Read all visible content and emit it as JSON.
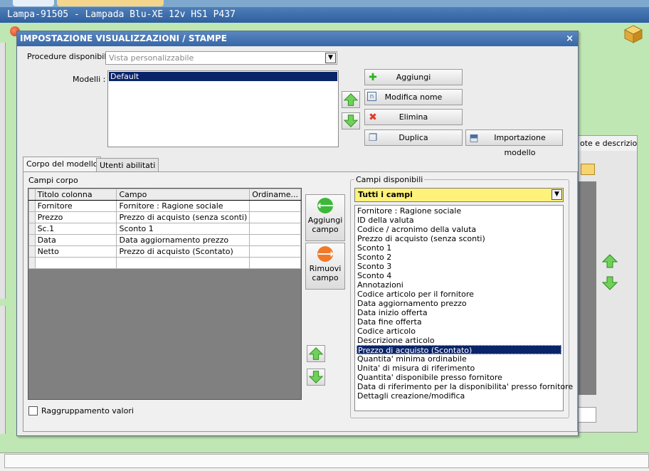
{
  "window": {
    "title": "Lampa-91505 - Lampada Blu-XE 12v HS1 P437"
  },
  "background": {
    "tab_note": "ote e descrizioni"
  },
  "dialog": {
    "title": "IMPOSTAZIONE VISUALIZZAZIONI / STAMPE",
    "close": "×",
    "procedure_label": "Procedure disponibili :",
    "procedure_value": "Vista personalizzabile",
    "modelli_label": "Modelli :",
    "modelli": [
      "Default"
    ],
    "buttons": {
      "aggiungi": "Aggiungi",
      "modifica": "Modifica nome",
      "elimina": "Elimina",
      "duplica": "Duplica",
      "importazione": "Importazione modello"
    },
    "tabs": [
      "Corpo del modello",
      "Utenti abilitati"
    ],
    "campi_corpo_label": "Campi corpo",
    "grid": {
      "columns": [
        "Titolo colonna",
        "Campo",
        "Ordiname..."
      ],
      "rows": [
        {
          "titolo": "Fornitore",
          "campo": "Fornitore : Ragione sociale",
          "ord": ""
        },
        {
          "titolo": "Prezzo",
          "campo": "Prezzo di acquisto (senza sconti)",
          "ord": ""
        },
        {
          "titolo": "Sc.1",
          "campo": "Sconto 1",
          "ord": ""
        },
        {
          "titolo": "Data",
          "campo": "Data aggiornamento prezzo",
          "ord": ""
        },
        {
          "titolo": "Netto",
          "campo": "Prezzo di acquisto (Scontato)",
          "ord": ""
        },
        {
          "titolo": "",
          "campo": "",
          "ord": ""
        }
      ]
    },
    "aggiungi_campo": [
      "Aggiungi",
      "campo"
    ],
    "rimuovi_campo": [
      "Rimuovi",
      "campo"
    ],
    "raggruppamento_label": "Raggruppamento valori",
    "campi_disponibili_label": "Campi disponibili",
    "campi_filter": "Tutti i campi",
    "campi_disponibili": [
      "Fornitore : Ragione sociale",
      "ID della valuta",
      "Codice / acronimo della valuta",
      "Prezzo di acquisto (senza sconti)",
      "Sconto 1",
      "Sconto 2",
      "Sconto 3",
      "Sconto 4",
      "Annotazioni",
      "Codice articolo per il fornitore",
      "Data aggiornamento prezzo",
      "Data inizio offerta",
      "Data fine offerta",
      "Codice articolo",
      "Descrizione articolo",
      "Prezzo di acquisto (Scontato)",
      "Quantita' minima ordinabile",
      "Unita' di misura di riferimento",
      "Quantita' disponibile presso fornitore",
      "Data di riferimento per la disponibilita' presso fornitore",
      "Dettagli creazione/modifica"
    ],
    "campi_selected_index": 15
  },
  "colors": {
    "selection": "#0a246a",
    "filter_bg": "#fff27a",
    "titlebar": "#3767a6",
    "app_bg": "#bfe7b3"
  }
}
